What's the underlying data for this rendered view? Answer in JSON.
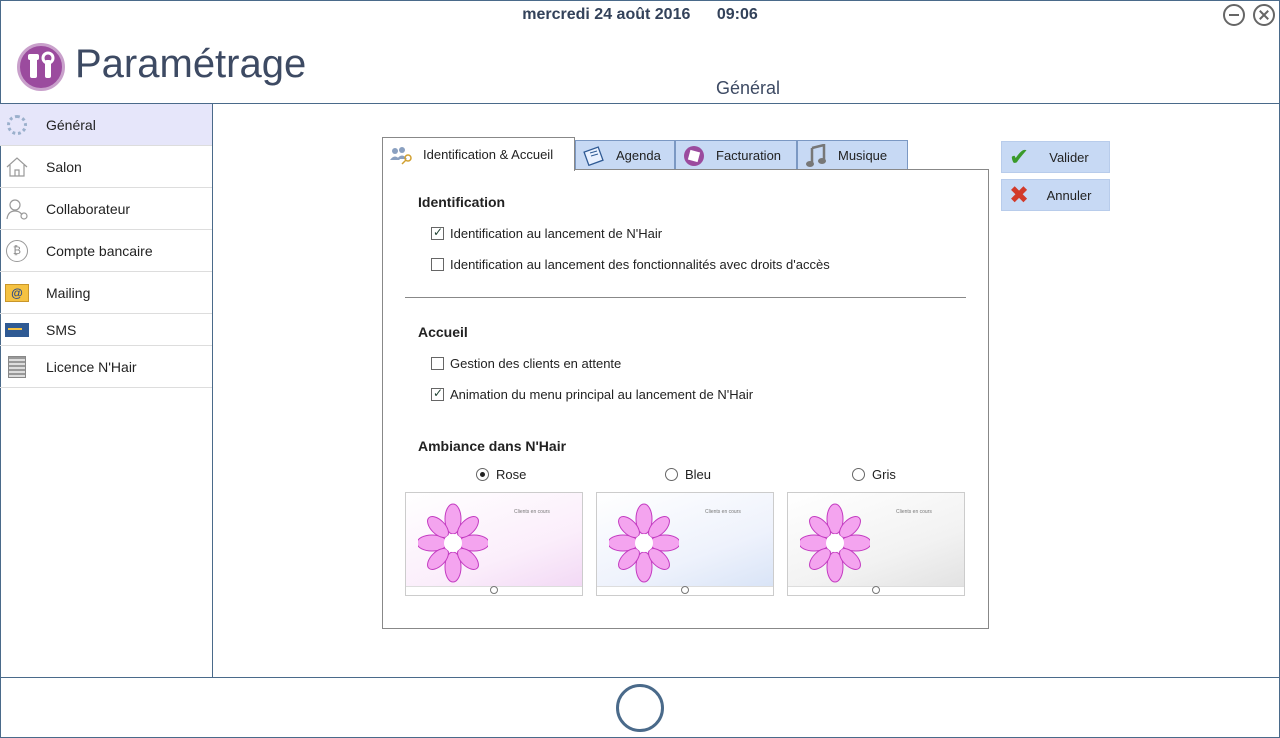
{
  "header": {
    "date": "mercredi 24 août 2016",
    "time": "09:06",
    "app_title": "Paramétrage",
    "section_title": "Général"
  },
  "sidebar": {
    "items": [
      {
        "label": "Général",
        "icon": "gears-icon",
        "active": true
      },
      {
        "label": "Salon",
        "icon": "house-icon"
      },
      {
        "label": "Collaborateur",
        "icon": "user-icon"
      },
      {
        "label": "Compte bancaire",
        "icon": "bank-coin-icon"
      },
      {
        "label": "Mailing",
        "icon": "mail-at-icon"
      },
      {
        "label": "SMS",
        "icon": "sms-icon"
      },
      {
        "label": "Licence N'Hair",
        "icon": "license-doc-icon"
      }
    ]
  },
  "tabs": [
    {
      "label": "Identification & Accueil",
      "icon": "users-key-icon",
      "active": true
    },
    {
      "label": "Agenda",
      "icon": "agenda-icon"
    },
    {
      "label": "Facturation",
      "icon": "invoice-icon"
    },
    {
      "label": "Musique",
      "icon": "music-note-icon"
    }
  ],
  "identification": {
    "title": "Identification",
    "options": [
      {
        "label": "Identification au lancement de N'Hair",
        "checked": true
      },
      {
        "label": "Identification au lancement des fonctionnalités avec droits d'accès",
        "checked": false
      }
    ]
  },
  "accueil": {
    "title": "Accueil",
    "options": [
      {
        "label": "Gestion des clients en attente",
        "checked": false
      },
      {
        "label": "Animation du menu principal au lancement de N'Hair",
        "checked": true
      }
    ]
  },
  "ambiance": {
    "title": "Ambiance dans N'Hair",
    "options": [
      {
        "label": "Rose",
        "selected": true
      },
      {
        "label": "Bleu",
        "selected": false
      },
      {
        "label": "Gris",
        "selected": false
      }
    ],
    "thumb_caption": "Clients en cours"
  },
  "actions": {
    "ok_label": "Valider",
    "cancel_label": "Annuler"
  },
  "colors": {
    "accent": "#9b4b9e",
    "button_bg": "#c7d9f4",
    "border": "#4a6a8a",
    "rose": "#e9a0e6",
    "bleu": "#a8c8ec",
    "gris": "#b4b4b4"
  }
}
